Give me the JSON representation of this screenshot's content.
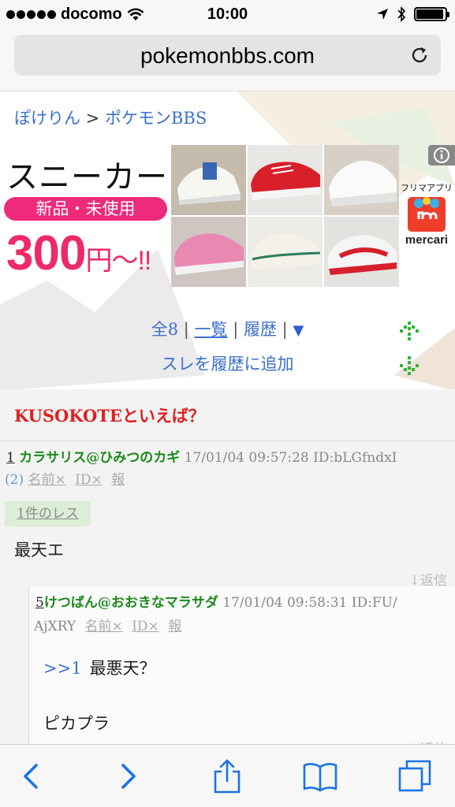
{
  "status": {
    "carrier": "docomo",
    "time": "10:00",
    "signal_icon": "signal-dots-icon",
    "battery_level": 0.95
  },
  "browser": {
    "url": "pokemonbbs.com"
  },
  "breadcrumb": {
    "home": "ぽけりん",
    "separator": " > ",
    "section": "ポケモンBBS"
  },
  "ad": {
    "title": "スニーカー",
    "badge": "新品・未使用",
    "price": "300",
    "price_suffix": "円〜!!",
    "brand_label": "フリマアプリ",
    "brand_name": "mercari",
    "info_icon": "info-icon"
  },
  "nav": {
    "count": "全8",
    "list": "一覧",
    "history": "履歴",
    "menu_icon": "▼",
    "sep": "|",
    "add_history": "スレを履歴に追加"
  },
  "thread": {
    "title": "KUSOKOTEといえば？"
  },
  "posts": [
    {
      "num": "1",
      "name": "カラサリス@ひみつのカギ",
      "meta": "17/01/04 09:57:28 ID:bLGfndxI",
      "reply_count": "(2)",
      "links": [
        "名前×",
        "ID×",
        "報"
      ],
      "res_label": "1件のレス",
      "body": "最天エ",
      "reply": "↓返信"
    },
    {
      "num": "5",
      "name": "けつばん@おおきなマラサダ",
      "meta_a": "17/01/04 09:58:31 ID:FU/",
      "meta_b": "AjXRY",
      "links": [
        "名前×",
        "ID×",
        "報"
      ],
      "quote_ref": ">>1",
      "quote_text": "最悪天？",
      "body": "ピカプラ",
      "reply": "↓返信"
    }
  ],
  "colors": {
    "link": "#3b6fd0",
    "thread_title": "#e02020",
    "name": "#1b8a1b",
    "ad_pink": "#ee2a7b"
  }
}
